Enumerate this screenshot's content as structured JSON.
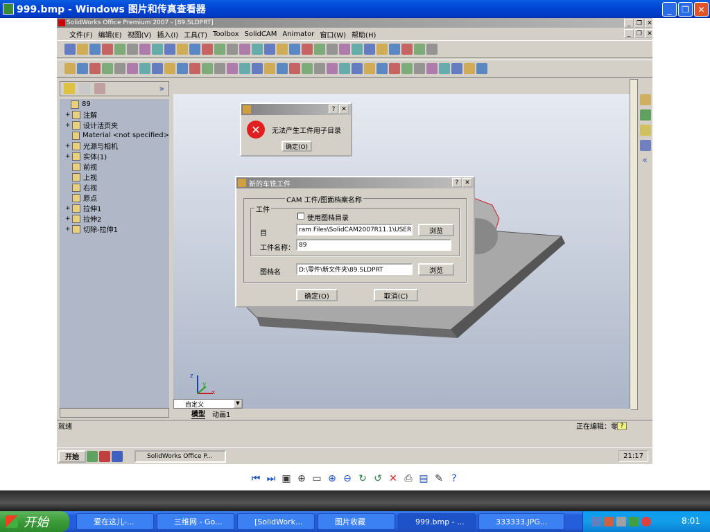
{
  "viewer": {
    "title": "999.bmp - Windows 图片和传真查看器",
    "minimize": "_",
    "restore": "❐",
    "close": "✕"
  },
  "solidworks": {
    "title": "SolidWorks Office Premium 2007 - [89.SLDPRT]",
    "menu": [
      "文件(F)",
      "编辑(E)",
      "视图(V)",
      "插入(I)",
      "工具(T)",
      "Toolbox",
      "SolidCAM",
      "Animator",
      "窗口(W)",
      "帮助(H)"
    ],
    "tree": [
      {
        "label": "89",
        "indent": 0,
        "expander": ""
      },
      {
        "label": "注解",
        "indent": 1,
        "expander": "+"
      },
      {
        "label": "设计活页夹",
        "indent": 1,
        "expander": "+"
      },
      {
        "label": "Material <not specified>",
        "indent": 1,
        "expander": ""
      },
      {
        "label": "光源与相机",
        "indent": 1,
        "expander": "+"
      },
      {
        "label": "实体(1)",
        "indent": 1,
        "expander": "+"
      },
      {
        "label": "前视",
        "indent": 1,
        "expander": ""
      },
      {
        "label": "上视",
        "indent": 1,
        "expander": ""
      },
      {
        "label": "右视",
        "indent": 1,
        "expander": ""
      },
      {
        "label": "原点",
        "indent": 1,
        "expander": ""
      },
      {
        "label": "拉伸1",
        "indent": 1,
        "expander": "+"
      },
      {
        "label": "拉伸2",
        "indent": 1,
        "expander": "+"
      },
      {
        "label": "切除-拉伸1",
        "indent": 1,
        "expander": "+"
      }
    ],
    "tabs": [
      "模型",
      "动画1"
    ],
    "view_combo": "自定义",
    "status_left": "就绪",
    "status_right": "正在编辑：零件",
    "status_help": "?",
    "axis": {
      "x": "x",
      "y": "y",
      "z": "z"
    }
  },
  "error_dialog": {
    "message": "无法产生工件用子目录",
    "ok_button": "确定(O)",
    "help": "?",
    "close": "✕"
  },
  "cam_dialog": {
    "title": "新的车铣工件",
    "group_title": "CAM 工件/图面档案名称",
    "workpiece_group": "工件",
    "use_doc_dir_label": "使用图档目录",
    "use_doc_dir_checked": false,
    "dir_label": "目",
    "dir_value": "ram Files\\SolidCAM2007R11.1\\USER",
    "browse1": "浏览",
    "name_label": "工件名称：",
    "name_value": "89",
    "doc_label": "图档名",
    "doc_value": "D:\\零件\\新文件夹\\89.SLDPRT",
    "browse2": "浏览",
    "ok_button": "确定(O)",
    "cancel_button": "取消(C)",
    "help": "?",
    "close": "✕"
  },
  "inner_taskbar": {
    "start": "开始",
    "task": "SolidWorks Office P...",
    "clock": "21:17"
  },
  "xp_taskbar": {
    "start": "开始",
    "tasks": [
      "爱在这儿-...",
      "三维网 - Go...",
      "[SolidWork...",
      "图片收藏",
      "999.bmp - ...",
      "333333.JPG..."
    ],
    "clock": "8:01"
  }
}
